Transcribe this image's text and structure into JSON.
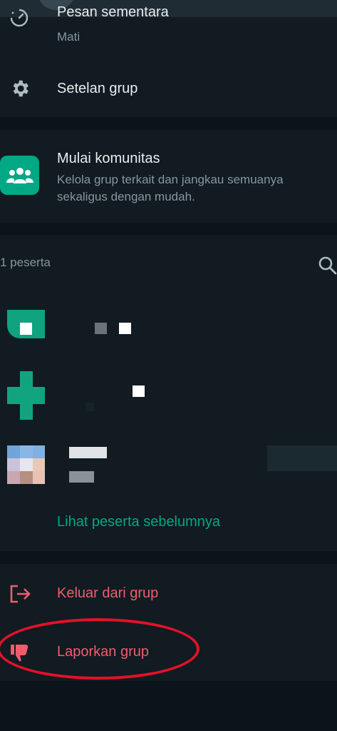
{
  "header": {
    "ephemeral_messages_title": "Pesan sementara",
    "ephemeral_messages_value": "Mati"
  },
  "settings": {
    "group_settings_label": "Setelan grup"
  },
  "community": {
    "title": "Mulai komunitas",
    "description": "Kelola grup terkait dan jangkau semuanya sekaligus dengan mudah."
  },
  "participants": {
    "count_label": "1 peserta",
    "view_previous_label": "Lihat peserta sebelumnya"
  },
  "actions": {
    "exit_group_label": "Keluar dari grup",
    "report_group_label": "Laporkan grup"
  },
  "colors": {
    "accent": "#00a884",
    "danger": "#f15c6d",
    "highlight": "#e5102a"
  }
}
